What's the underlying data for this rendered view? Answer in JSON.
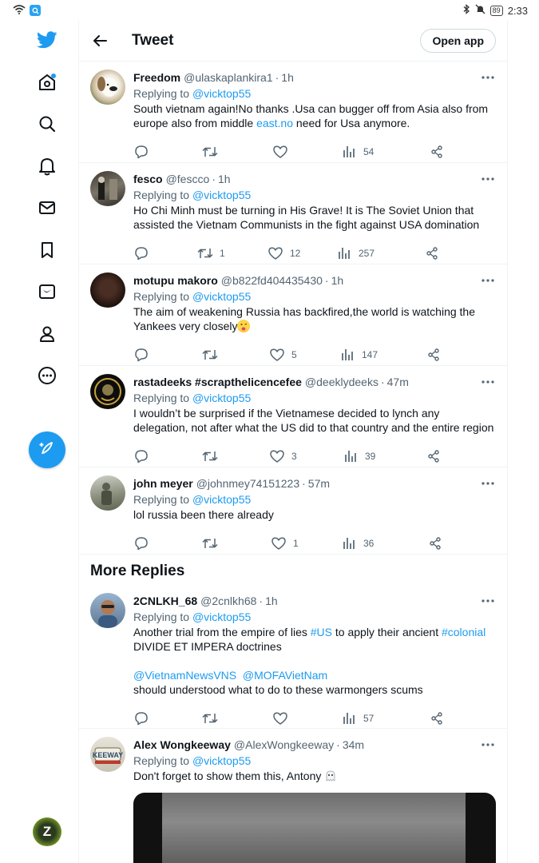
{
  "status_bar": {
    "time": "2:33",
    "battery": "89"
  },
  "header": {
    "title": "Tweet",
    "open_app_label": "Open app"
  },
  "section": {
    "more_replies": "More Replies"
  },
  "tweets": [
    {
      "name": "Freedom",
      "handle": "@ulaskaplankira1",
      "time": "1h",
      "replying_label": "Replying to",
      "replying_to": "@vicktop55",
      "text_a": "South vietnam again!No thanks .Usa can bugger off from Asia  also from europe also from middle ",
      "text_link": "east.no",
      "text_b": " need for Usa anymore.",
      "retweets": "",
      "likes": "",
      "views": "54"
    },
    {
      "name": "fesco",
      "handle": "@fescco",
      "time": "1h",
      "replying_label": "Replying to",
      "replying_to": "@vicktop55",
      "text": "Ho Chi Minh must be turning in His Grave! It is The Soviet Union that assisted the Vietnam Communists in the fight against USA domination",
      "retweets": "1",
      "likes": "12",
      "views": "257"
    },
    {
      "name": "motupu makoro",
      "handle": "@b822fd404435430",
      "time": "1h",
      "replying_label": "Replying to",
      "replying_to": "@vicktop55",
      "text": "The aim of weakening Russia has backfired,the world is watching the Yankees very closely",
      "retweets": "",
      "likes": "5",
      "views": "147"
    },
    {
      "name": "rastadeeks #scrapthelicencefee",
      "handle": "@deeklydeeks",
      "time": "47m",
      "replying_label": "Replying to",
      "replying_to": "@vicktop55",
      "text": "I wouldn’t be surprised if the Vietnamese decided to lynch any delegation, not after what the US did to that country and the entire region",
      "retweets": "",
      "likes": "3",
      "views": "39"
    },
    {
      "name": "john meyer",
      "handle": "@johnmey74151223",
      "time": "57m",
      "replying_label": "Replying to",
      "replying_to": "@vicktop55",
      "text": "lol russia been there already",
      "retweets": "",
      "likes": "1",
      "views": "36"
    },
    {
      "name": "2CNLKH_68",
      "handle": "@2cnlkh68",
      "time": "1h",
      "replying_label": "Replying to",
      "replying_to": "@vicktop55",
      "text_a": "Another trial from the empire of lies ",
      "tag1": "#US",
      "text_b": " to apply their ancient ",
      "tag2": "#colonial",
      "text_c": "DIVIDE ET IMPERA doctrines",
      "mention1": "@VietnamNewsVNS",
      "mention2": "@MOFAVietNam",
      "text_d": "should understood what to do to these warmongers scums",
      "retweets": "",
      "likes": "",
      "views": "57"
    },
    {
      "name": "Alex Wongkeeway",
      "handle": "@AlexWongkeeway",
      "time": "34m",
      "replying_label": "Replying to",
      "replying_to": "@vicktop55",
      "text": "Don't forget to show them this, Antony"
    }
  ],
  "nav": [
    "twitter-logo",
    "home-icon",
    "search-icon",
    "bell-icon",
    "mail-icon",
    "bookmark-icon",
    "twitter-blue-icon",
    "profile-icon",
    "more-circle-icon",
    "compose-icon"
  ],
  "accent": "#1d9bf0",
  "profile_initial": "Z"
}
